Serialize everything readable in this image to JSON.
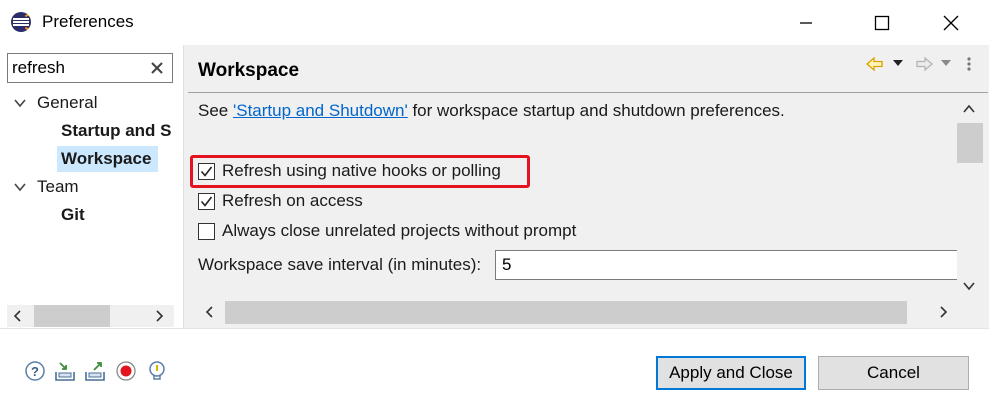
{
  "window": {
    "title": "Preferences",
    "icon": "eclipse-icon",
    "controls": [
      "minimize-icon",
      "maximize-icon",
      "close-icon"
    ]
  },
  "filter": {
    "value": "refresh",
    "clear_icon": "clear-icon"
  },
  "tree": {
    "items": [
      {
        "label": "General",
        "expanded": true,
        "level": 0
      },
      {
        "label": "Startup and S",
        "level": 1
      },
      {
        "label": "Workspace",
        "level": 1,
        "selected": true
      },
      {
        "label": "Team",
        "expanded": true,
        "level": 0
      },
      {
        "label": "Git",
        "level": 1
      }
    ]
  },
  "page": {
    "title": "Workspace",
    "description_prefix": "See ",
    "description_link": "'Startup and Shutdown'",
    "description_suffix": " for workspace startup and shutdown preferences.",
    "options": [
      {
        "label": "Refresh using native hooks or polling",
        "checked": true,
        "highlighted": true
      },
      {
        "label": "Refresh on access",
        "checked": true
      },
      {
        "label": "Always close unrelated projects without prompt",
        "checked": false
      }
    ],
    "save_interval_label": "Workspace save interval (in minutes):",
    "save_interval_value": "5"
  },
  "nav_icons": [
    "back-arrow-icon",
    "back-dropdown-icon",
    "forward-arrow-icon",
    "forward-dropdown-icon",
    "view-menu-icon"
  ],
  "bottom": {
    "tool_icons": [
      "help-icon",
      "import-icon",
      "export-icon",
      "record-icon",
      "tip-icon"
    ],
    "apply_label": "Apply and Close",
    "cancel_label": "Cancel"
  },
  "colors": {
    "highlight": "#e3131f",
    "link": "#0066cc",
    "selection": "#cce8ff",
    "default_button_border": "#0078d7"
  }
}
